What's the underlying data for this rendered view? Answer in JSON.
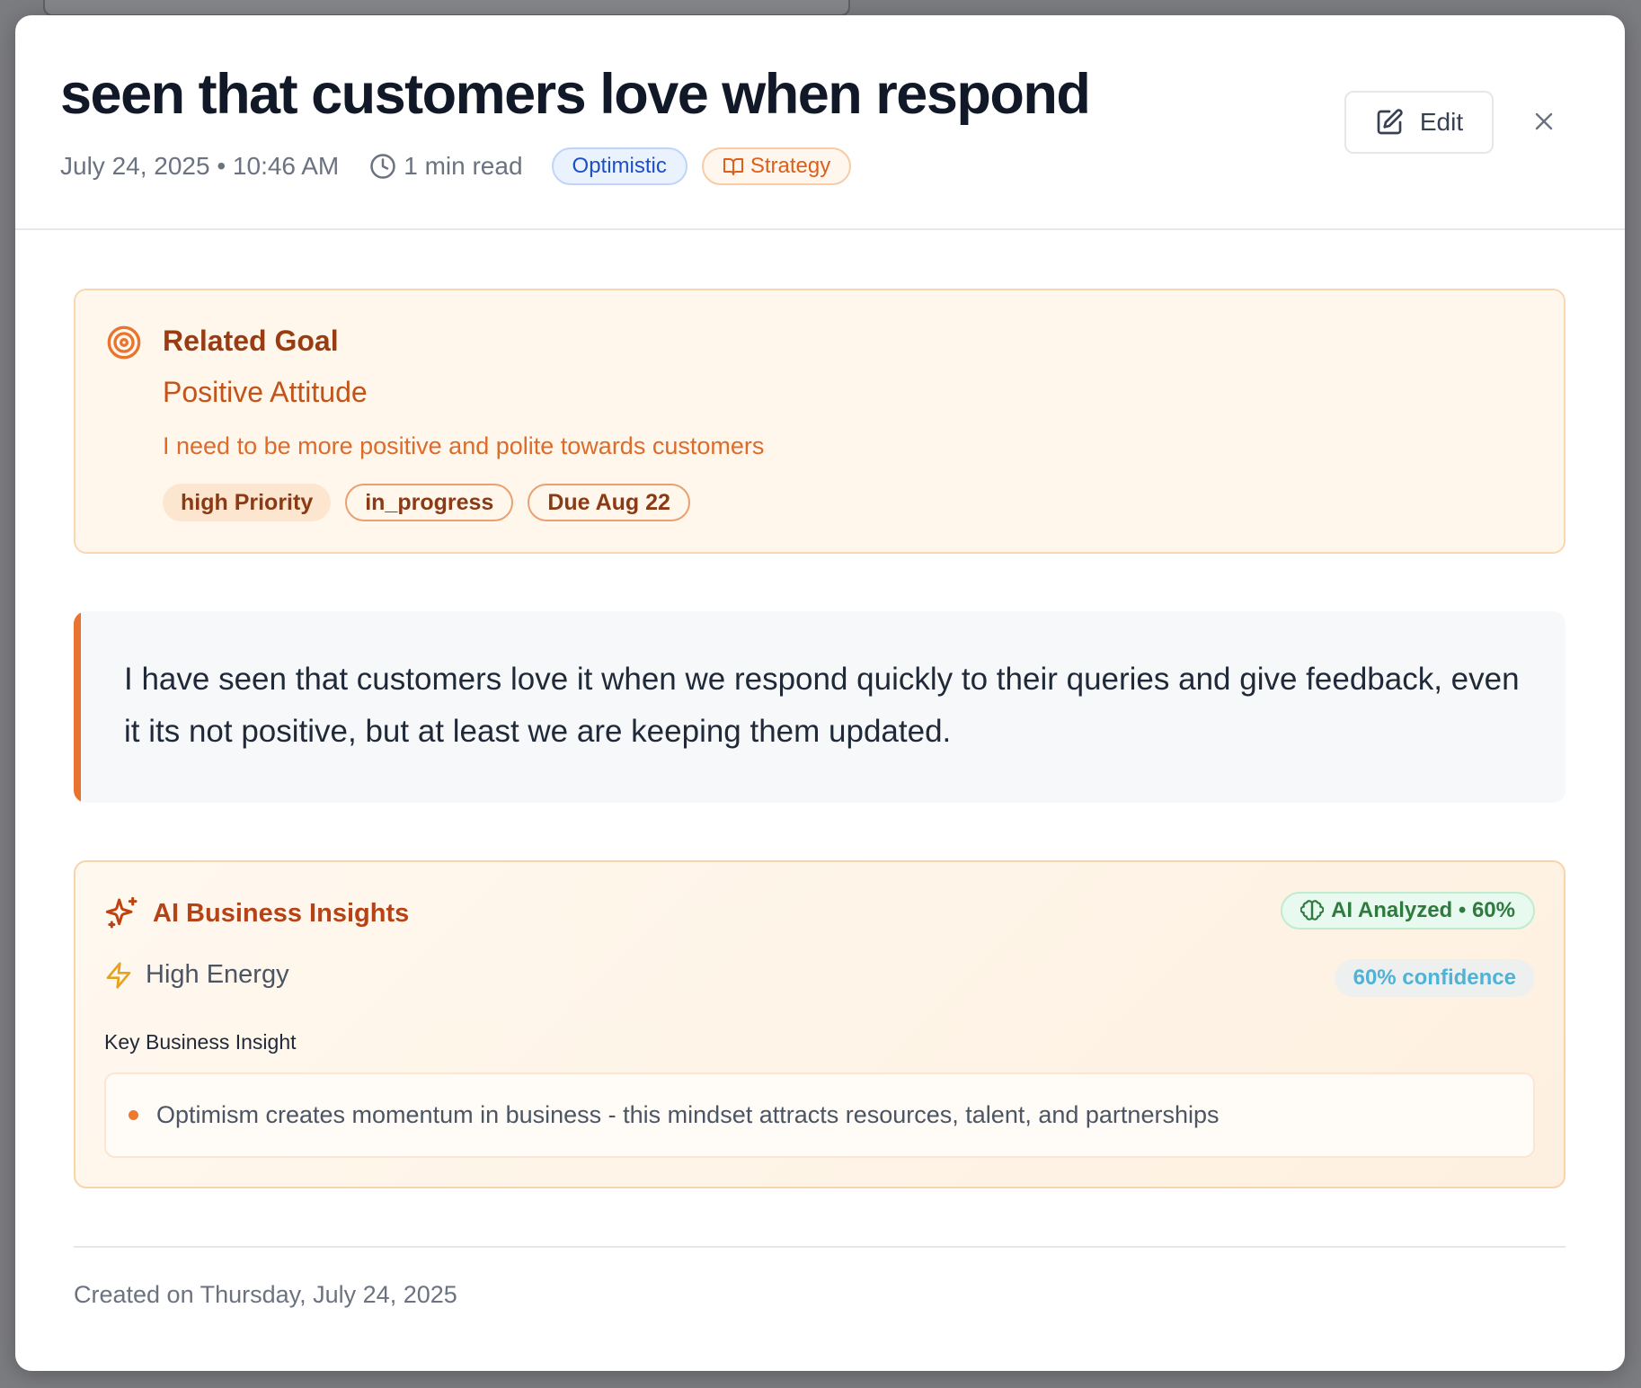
{
  "entry": {
    "title": "seen that customers love when respond",
    "date_time": "July 24, 2025 • 10:46 AM",
    "read_time": "1 min read",
    "mood_tag": "Optimistic",
    "category_tag": "Strategy",
    "edit_label": "Edit",
    "close_icon": "×"
  },
  "goal": {
    "section_label": "Related Goal",
    "name": "Positive Attitude",
    "description": "I need to be more positive and polite towards customers",
    "tags": [
      "high Priority",
      "in_progress",
      "Due Aug 22"
    ]
  },
  "body": {
    "text": "I have seen that customers love it when we respond quickly to their queries and give feedback, even it its not positive, but at least we are keeping them updated."
  },
  "insights": {
    "title": "AI Business Insights",
    "badge": "AI Analyzed • 60%",
    "energy": "High Energy",
    "confidence": "60% confidence",
    "key_label": "Key Business Insight",
    "items": [
      "Optimism creates momentum in business - this mindset attracts resources, talent, and partnerships"
    ]
  },
  "footer": {
    "created": "Created on Thursday, July 24, 2025"
  },
  "icons": {
    "clock": "clock-icon",
    "book": "book-icon",
    "edit": "pencil-square-icon",
    "close": "close-icon",
    "target": "target-icon",
    "sparkles": "sparkles-icon",
    "brain": "brain-icon",
    "zap": "lightning-icon"
  },
  "colors": {
    "accent_orange": "#e8742f",
    "goal_title": "#9a3c12",
    "mood_blue": "#1d4fc4",
    "ai_green": "#2f7a3f",
    "confidence_blue": "#4fb2d6"
  }
}
